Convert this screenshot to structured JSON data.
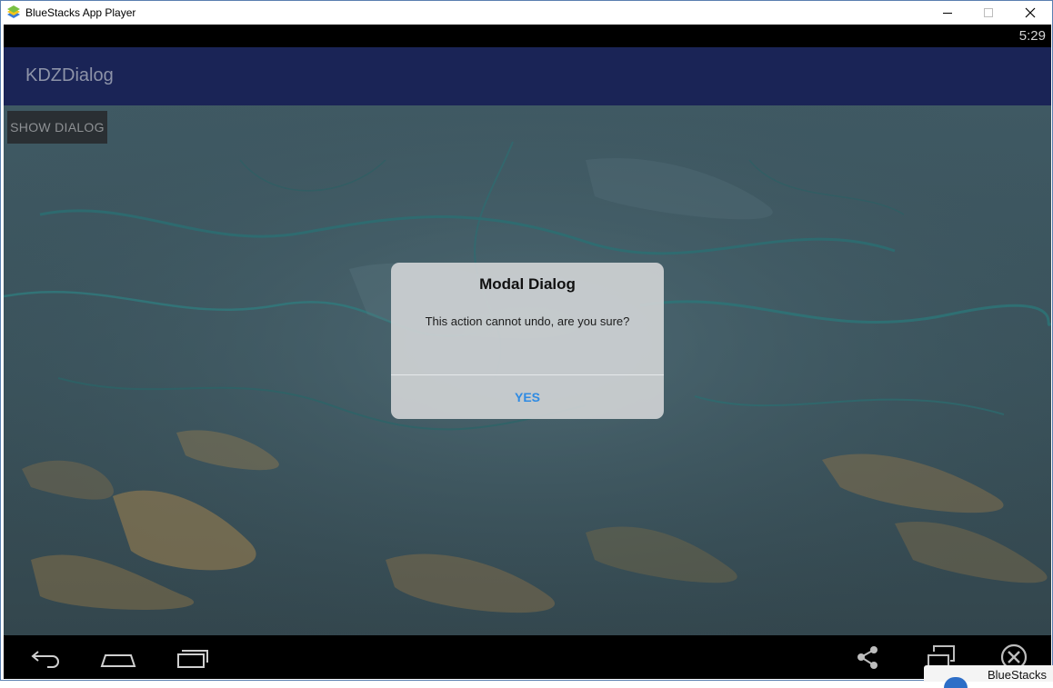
{
  "window": {
    "title": "BlueStacks App Player"
  },
  "android": {
    "clock": "5:29",
    "app_name": "KDZDialog",
    "show_button_label": "SHOW DIALOG",
    "dialog": {
      "title": "Modal Dialog",
      "message": "This action cannot undo, are you sure?",
      "yes_label": "YES"
    }
  },
  "badge": {
    "text": "BlueStacks"
  },
  "icons": {
    "app": "bluestacks-logo-icon",
    "minimize": "minimize-icon",
    "maximize": "maximize-icon",
    "close": "close-icon",
    "back": "back-icon",
    "home": "home-icon",
    "recents": "recent-apps-icon",
    "share": "share-icon",
    "resize": "window-resize-icon",
    "close_app": "close-circle-icon"
  },
  "colors": {
    "actionbar": "#1a2456",
    "dialog_accent": "#2f8be3",
    "statusbar": "#000000"
  }
}
